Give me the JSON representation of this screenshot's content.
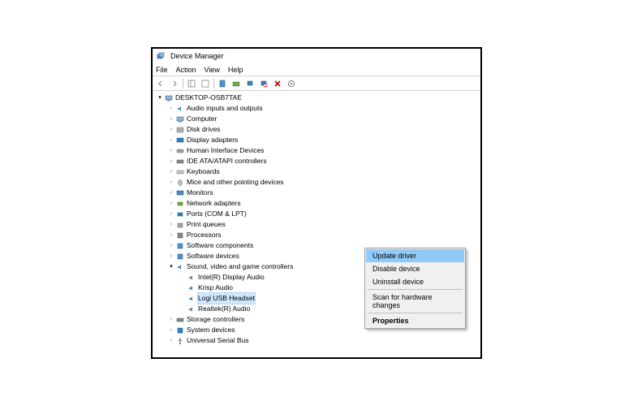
{
  "title": "Device Manager",
  "menu": [
    "File",
    "Action",
    "View",
    "Help"
  ],
  "root": "DESKTOP-OSB7TAE",
  "nodes": [
    {
      "kind": "audio",
      "label": "Audio inputs and outputs"
    },
    {
      "kind": "pc",
      "label": "Computer"
    },
    {
      "kind": "disk",
      "label": "Disk drives"
    },
    {
      "kind": "display",
      "label": "Display adapters"
    },
    {
      "kind": "hid",
      "label": "Human Interface Devices"
    },
    {
      "kind": "ide",
      "label": "IDE ATA/ATAPI controllers"
    },
    {
      "kind": "kbd",
      "label": "Keyboards"
    },
    {
      "kind": "mouse",
      "label": "Mice and other pointing devices"
    },
    {
      "kind": "monitor",
      "label": "Monitors"
    },
    {
      "kind": "net",
      "label": "Network adapters"
    },
    {
      "kind": "port",
      "label": "Ports (COM & LPT)"
    },
    {
      "kind": "print",
      "label": "Print queues"
    },
    {
      "kind": "cpu",
      "label": "Processors"
    },
    {
      "kind": "sw",
      "label": "Software components"
    },
    {
      "kind": "sw",
      "label": "Software devices"
    }
  ],
  "sound_label": "Sound, video and game controllers",
  "sound_children": [
    "Intel(R) Display Audio",
    "Krisp Audio",
    "Logi USB Headset",
    "Realtek(R) Audio"
  ],
  "after": [
    {
      "kind": "storage",
      "label": "Storage controllers"
    },
    {
      "kind": "sys",
      "label": "System devices"
    },
    {
      "kind": "usb",
      "label": "Universal Serial Bus"
    }
  ],
  "context": {
    "items": [
      "Update driver",
      "Disable device",
      "Uninstall device"
    ],
    "scan": "Scan for hardware changes",
    "props": "Properties"
  }
}
